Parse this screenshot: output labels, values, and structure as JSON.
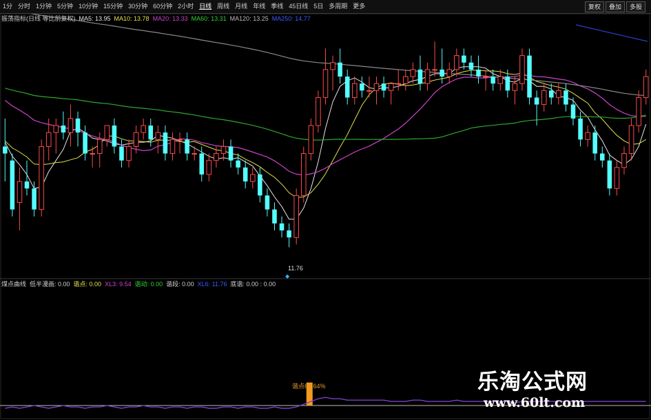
{
  "toolbar": {
    "periods": [
      "1分",
      "分时",
      "1分钟",
      "5分钟",
      "10分钟",
      "15分钟",
      "30分钟",
      "60分钟",
      "2小时",
      "日线",
      "周线",
      "月线",
      "年线",
      "季线",
      "45日线",
      "5日",
      "多周期",
      "更多"
    ],
    "active_period": "日线",
    "right_buttons": [
      "复权",
      "叠加",
      "多股"
    ]
  },
  "main_legend": {
    "title": "振荡指标(日线 等比前复权)",
    "items": [
      {
        "label": "MA5: 13.95",
        "color": "#e6e6e6"
      },
      {
        "label": "MA10: 13.78",
        "color": "#e5e04a"
      },
      {
        "label": "MA20: 13.33",
        "color": "#cc44cc"
      },
      {
        "label": "MA60: 13.31",
        "color": "#34d134"
      },
      {
        "label": "MA120: 13.25",
        "color": "#bdbdbd"
      },
      {
        "label": "MA250: 14.77",
        "color": "#3a5cff"
      }
    ]
  },
  "indicator_legend": {
    "items": [
      {
        "label": "煤点曲线",
        "color": "#cfcfcf"
      },
      {
        "label": "低半漫画: 0.00",
        "color": "#cfcfcf"
      },
      {
        "label": "谐点: 0.00",
        "color": "#e5e04a"
      },
      {
        "label": "XL3: 9.54",
        "color": "#cc44cc"
      },
      {
        "label": "谐动: 0.00",
        "color": "#34d134"
      },
      {
        "label": "谐段: 0.00",
        "color": "#cfcfcf"
      },
      {
        "label": "XL6: 11.76",
        "color": "#3a5cff"
      },
      {
        "label": "底谐: 0.00 : 0.00",
        "color": "#cfcfcf"
      }
    ]
  },
  "annotations": {
    "low_price": "11.76",
    "bar_label": "谐点60.64%"
  },
  "watermark": {
    "title": "乐淘公式网",
    "url": "www.60lt.com"
  },
  "colors": {
    "up": "#ff4a4a",
    "down": "#54ffff",
    "ma5": "#e6e6e6",
    "ma10": "#e5e04a",
    "ma20": "#cc44cc",
    "ma60": "#2ea82e",
    "ma120": "#8a8a8a",
    "ma250": "#2e3ec4",
    "ind_bar": "#f39a1e",
    "ind_line": "#7a40c8"
  },
  "chart_data": {
    "type": "candlestick",
    "period": "日线",
    "low_value": 11.76,
    "candles": [
      [
        13.2,
        13.6,
        12.7,
        13.1
      ],
      [
        13.0,
        13.1,
        12.2,
        12.3
      ],
      [
        12.4,
        12.9,
        12.0,
        12.7
      ],
      [
        12.7,
        13.0,
        12.5,
        12.6
      ],
      [
        12.6,
        12.7,
        12.2,
        12.3
      ],
      [
        12.3,
        13.3,
        12.2,
        13.2
      ],
      [
        13.2,
        13.6,
        13.0,
        13.4
      ],
      [
        13.4,
        13.6,
        13.1,
        13.5
      ],
      [
        13.5,
        13.7,
        13.3,
        13.4
      ],
      [
        13.4,
        13.8,
        13.2,
        13.6
      ],
      [
        13.6,
        13.7,
        13.2,
        13.4
      ],
      [
        13.4,
        13.5,
        13.0,
        13.1
      ],
      [
        13.1,
        13.2,
        12.9,
        13.1
      ],
      [
        13.1,
        13.4,
        12.9,
        13.3
      ],
      [
        13.3,
        13.5,
        13.2,
        13.5
      ],
      [
        13.5,
        13.6,
        13.1,
        13.2
      ],
      [
        13.2,
        13.3,
        12.9,
        13.0
      ],
      [
        13.0,
        13.3,
        12.9,
        13.2
      ],
      [
        13.2,
        13.5,
        13.1,
        13.4
      ],
      [
        13.4,
        13.6,
        13.3,
        13.5
      ],
      [
        13.5,
        13.6,
        13.2,
        13.3
      ],
      [
        13.3,
        13.5,
        13.1,
        13.4
      ],
      [
        13.4,
        13.5,
        13.0,
        13.1
      ],
      [
        13.1,
        13.4,
        13.0,
        13.3
      ],
      [
        13.3,
        13.4,
        13.1,
        13.3
      ],
      [
        13.3,
        13.4,
        13.0,
        13.1
      ],
      [
        13.1,
        13.2,
        13.0,
        13.1
      ],
      [
        13.1,
        13.2,
        12.7,
        12.8
      ],
      [
        12.8,
        13.1,
        12.7,
        13.0
      ],
      [
        13.0,
        13.2,
        12.9,
        13.1
      ],
      [
        13.1,
        13.3,
        13.0,
        13.2
      ],
      [
        13.2,
        13.3,
        12.9,
        13.0
      ],
      [
        13.0,
        13.1,
        12.8,
        12.9
      ],
      [
        12.9,
        13.0,
        12.6,
        12.7
      ],
      [
        12.7,
        12.9,
        12.6,
        12.8
      ],
      [
        12.8,
        12.9,
        12.4,
        12.5
      ],
      [
        12.5,
        12.6,
        12.2,
        12.3
      ],
      [
        12.3,
        12.4,
        12.0,
        12.1
      ],
      [
        12.1,
        12.2,
        11.9,
        12.0
      ],
      [
        12.0,
        12.1,
        11.76,
        11.9
      ],
      [
        11.9,
        12.6,
        11.8,
        12.5
      ],
      [
        12.5,
        13.2,
        12.4,
        13.1
      ],
      [
        13.1,
        13.6,
        13.0,
        13.5
      ],
      [
        13.5,
        14.0,
        13.4,
        13.9
      ],
      [
        13.9,
        14.6,
        13.8,
        14.3
      ],
      [
        14.3,
        14.5,
        14.0,
        14.4
      ],
      [
        14.4,
        14.6,
        14.1,
        14.2
      ],
      [
        14.2,
        14.3,
        13.8,
        13.9
      ],
      [
        13.9,
        14.2,
        13.8,
        14.1
      ],
      [
        14.1,
        14.2,
        13.9,
        14.0
      ],
      [
        14.0,
        14.2,
        13.9,
        14.0
      ],
      [
        14.0,
        14.2,
        13.8,
        14.1
      ],
      [
        14.1,
        14.2,
        13.9,
        14.0
      ],
      [
        14.0,
        14.1,
        13.8,
        14.1
      ],
      [
        14.1,
        14.3,
        14.0,
        14.1
      ],
      [
        14.1,
        14.3,
        14.0,
        14.2
      ],
      [
        14.2,
        14.4,
        14.1,
        14.3
      ],
      [
        14.3,
        14.5,
        14.0,
        14.1
      ],
      [
        14.1,
        14.4,
        14.0,
        14.3
      ],
      [
        14.3,
        14.7,
        14.2,
        14.3
      ],
      [
        14.3,
        14.6,
        14.1,
        14.2
      ],
      [
        14.2,
        14.4,
        14.1,
        14.3
      ],
      [
        14.3,
        14.6,
        14.2,
        14.5
      ],
      [
        14.5,
        14.6,
        14.3,
        14.4
      ],
      [
        14.4,
        14.5,
        14.2,
        14.3
      ],
      [
        14.3,
        14.5,
        14.1,
        14.2
      ],
      [
        14.2,
        14.3,
        14.0,
        14.2
      ],
      [
        14.2,
        14.3,
        14.0,
        14.1
      ],
      [
        14.1,
        14.3,
        14.0,
        14.2
      ],
      [
        14.2,
        14.3,
        13.9,
        14.0
      ],
      [
        14.0,
        14.2,
        13.8,
        14.1
      ],
      [
        14.1,
        14.6,
        14.0,
        14.5
      ],
      [
        14.5,
        14.6,
        13.8,
        13.9
      ],
      [
        13.9,
        14.0,
        13.5,
        13.8
      ],
      [
        13.8,
        14.1,
        13.7,
        14.0
      ],
      [
        14.0,
        14.1,
        13.8,
        13.9
      ],
      [
        13.9,
        14.1,
        13.8,
        14.0
      ],
      [
        14.0,
        14.1,
        13.7,
        13.8
      ],
      [
        13.8,
        13.9,
        13.5,
        13.6
      ],
      [
        13.6,
        13.7,
        13.2,
        13.3
      ],
      [
        13.3,
        13.5,
        13.2,
        13.4
      ],
      [
        13.4,
        13.5,
        13.0,
        13.1
      ],
      [
        13.1,
        13.2,
        12.9,
        13.0
      ],
      [
        13.0,
        13.1,
        12.5,
        12.6
      ],
      [
        12.6,
        13.0,
        12.5,
        12.9
      ],
      [
        12.9,
        13.2,
        12.8,
        13.1
      ],
      [
        13.1,
        13.6,
        13.0,
        13.5
      ],
      [
        13.5,
        14.0,
        13.4,
        13.9
      ],
      [
        13.9,
        14.3,
        13.8,
        14.2
      ]
    ],
    "ma250_points": [
      [
        836,
        36
      ],
      [
        940,
        60
      ]
    ],
    "indicator": {
      "bar_index": 41,
      "bar_value": 60.64,
      "line": [
        2,
        3,
        2,
        3,
        4,
        3,
        2,
        3,
        4,
        3,
        3,
        2,
        3,
        3,
        4,
        3,
        2,
        3,
        3,
        4,
        3,
        3,
        2,
        3,
        3,
        2,
        3,
        3,
        2,
        2,
        3,
        3,
        2,
        3,
        3,
        2,
        2,
        3,
        2,
        2,
        3,
        5,
        7,
        9,
        10,
        9,
        9,
        8,
        8,
        8,
        8,
        8,
        8,
        7,
        7,
        7,
        8,
        8,
        7,
        7,
        7,
        7,
        8,
        7,
        7,
        7,
        7,
        7,
        7,
        7,
        6,
        7,
        7,
        7,
        7,
        7,
        7,
        7,
        7,
        7,
        7,
        7,
        7,
        7,
        7,
        7,
        7,
        7,
        7
      ]
    }
  }
}
